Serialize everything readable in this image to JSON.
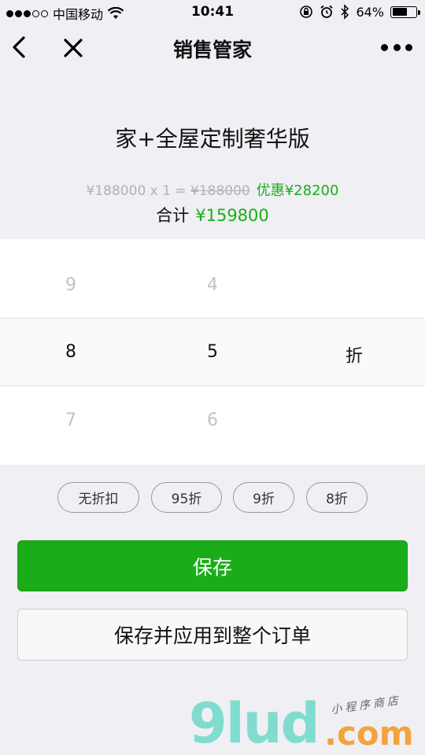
{
  "status_bar": {
    "carrier": "中国移动",
    "time": "10:41",
    "battery": "64%",
    "battery_level": 0.64,
    "signal_bars_on": 3,
    "signal_bars_total": 5
  },
  "nav": {
    "title": "销售管家",
    "back_icon": "chevron-left-icon",
    "close_icon": "close-icon",
    "more_icon": "more-dots-icon"
  },
  "product": {
    "name": "家+全屋定制奢华版",
    "unit_price_text": "¥188000 x 1 = ",
    "original_total": "¥188000",
    "discount_text": "优惠¥28200",
    "total_label": "合计",
    "total_value": "¥159800"
  },
  "picker": {
    "above": [
      "9",
      "4"
    ],
    "selected": [
      "8",
      "5"
    ],
    "below": [
      "7",
      "6"
    ],
    "unit": "折"
  },
  "chips": [
    "无折扣",
    "95折",
    "9折",
    "8折"
  ],
  "buttons": {
    "save": "保存",
    "save_apply_all": "保存并应用到整个订单"
  },
  "watermark": {
    "logo": "9lud",
    "suffix": ".com",
    "sub": "小程序商店"
  },
  "colors": {
    "accent_green": "#1aad19",
    "background": "#efeff4"
  }
}
